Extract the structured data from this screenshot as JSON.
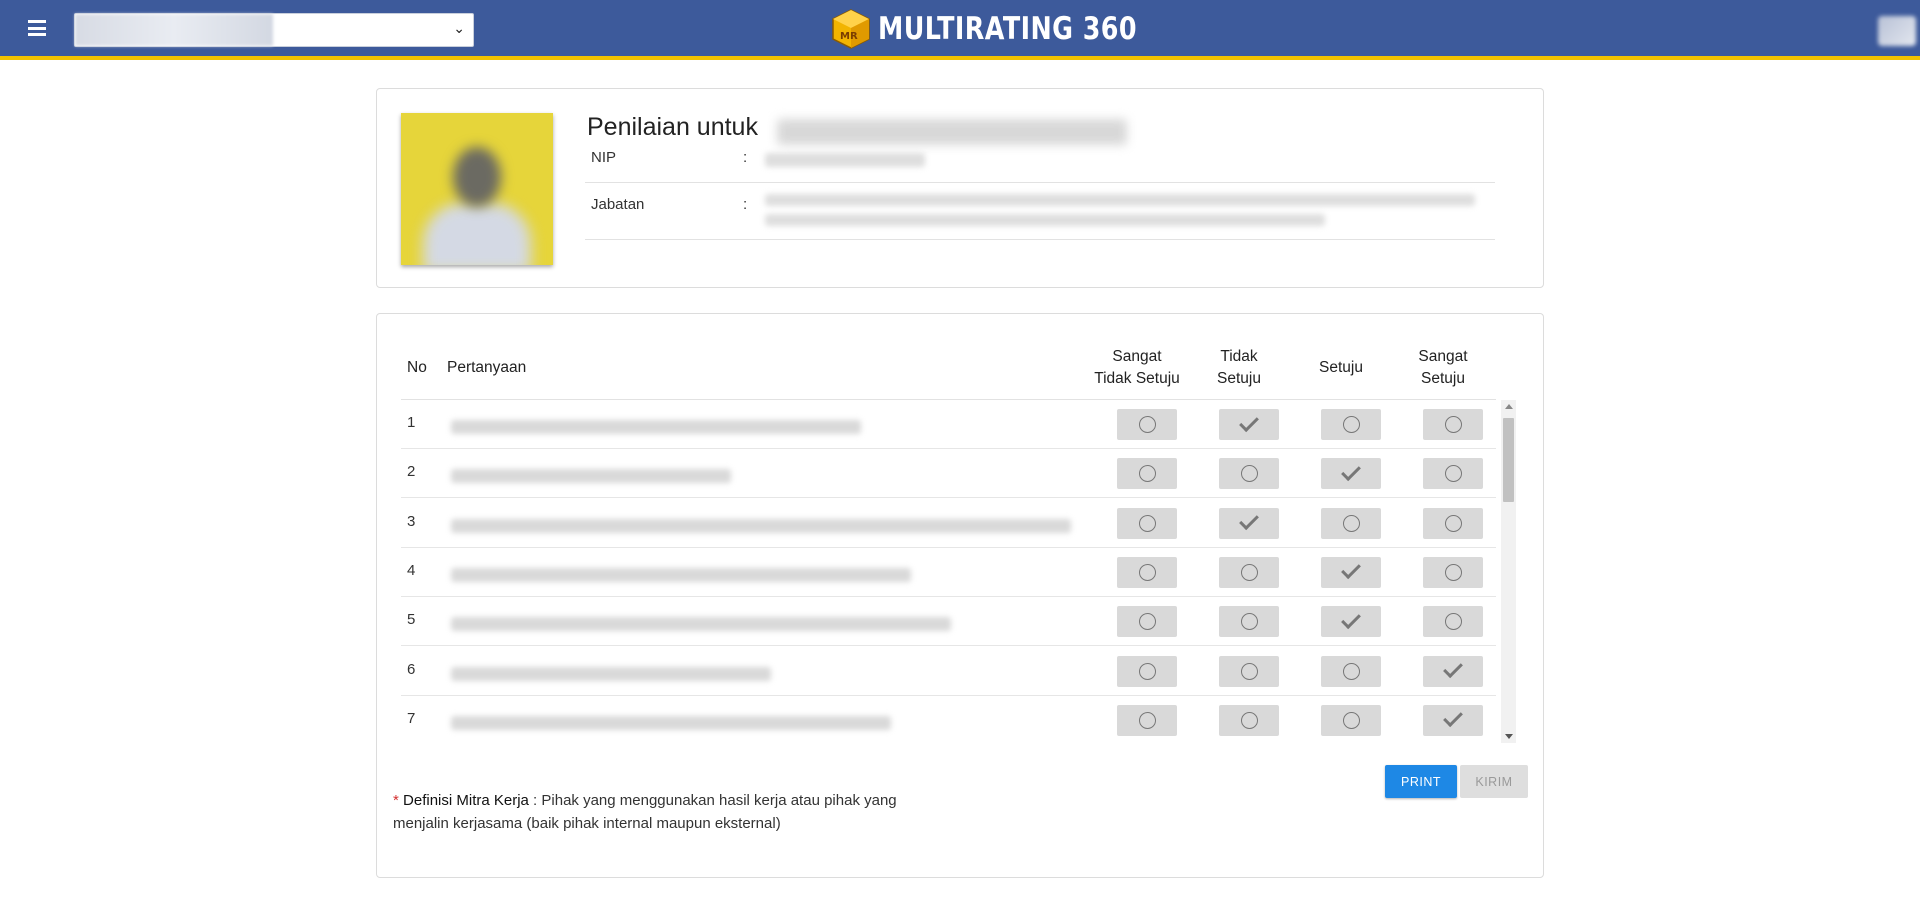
{
  "header": {
    "brand": "MULTIRATING 360",
    "logo_icon": "cube-logo-icon",
    "colors": {
      "bar": "#3d5a9b",
      "accent": "#f2c200"
    }
  },
  "profile": {
    "title": "Penilaian untuk",
    "nip_label": "NIP",
    "jabatan_label": "Jabatan",
    "separator": ":"
  },
  "table": {
    "col_no": "No",
    "col_question": "Pertanyaan",
    "options": [
      {
        "line1": "Sangat",
        "line2": "Tidak Setuju"
      },
      {
        "line1": "Tidak",
        "line2": "Setuju"
      },
      {
        "line1": "Setuju",
        "line2": ""
      },
      {
        "line1": "Sangat",
        "line2": "Setuju"
      }
    ],
    "rows": [
      {
        "no": "1",
        "selected": 1
      },
      {
        "no": "2",
        "selected": 2
      },
      {
        "no": "3",
        "selected": 1
      },
      {
        "no": "4",
        "selected": 2
      },
      {
        "no": "5",
        "selected": 2
      },
      {
        "no": "6",
        "selected": 3
      },
      {
        "no": "7",
        "selected": 3
      }
    ]
  },
  "actions": {
    "print_label": "PRINT",
    "send_label": "KIRIM"
  },
  "definition": {
    "star": "*",
    "term": "Definisi Mitra Kerja",
    "text": " : Pihak yang menggunakan hasil kerja atau pihak yang menjalin kerjasama (baik pihak internal maupun eksternal)"
  }
}
